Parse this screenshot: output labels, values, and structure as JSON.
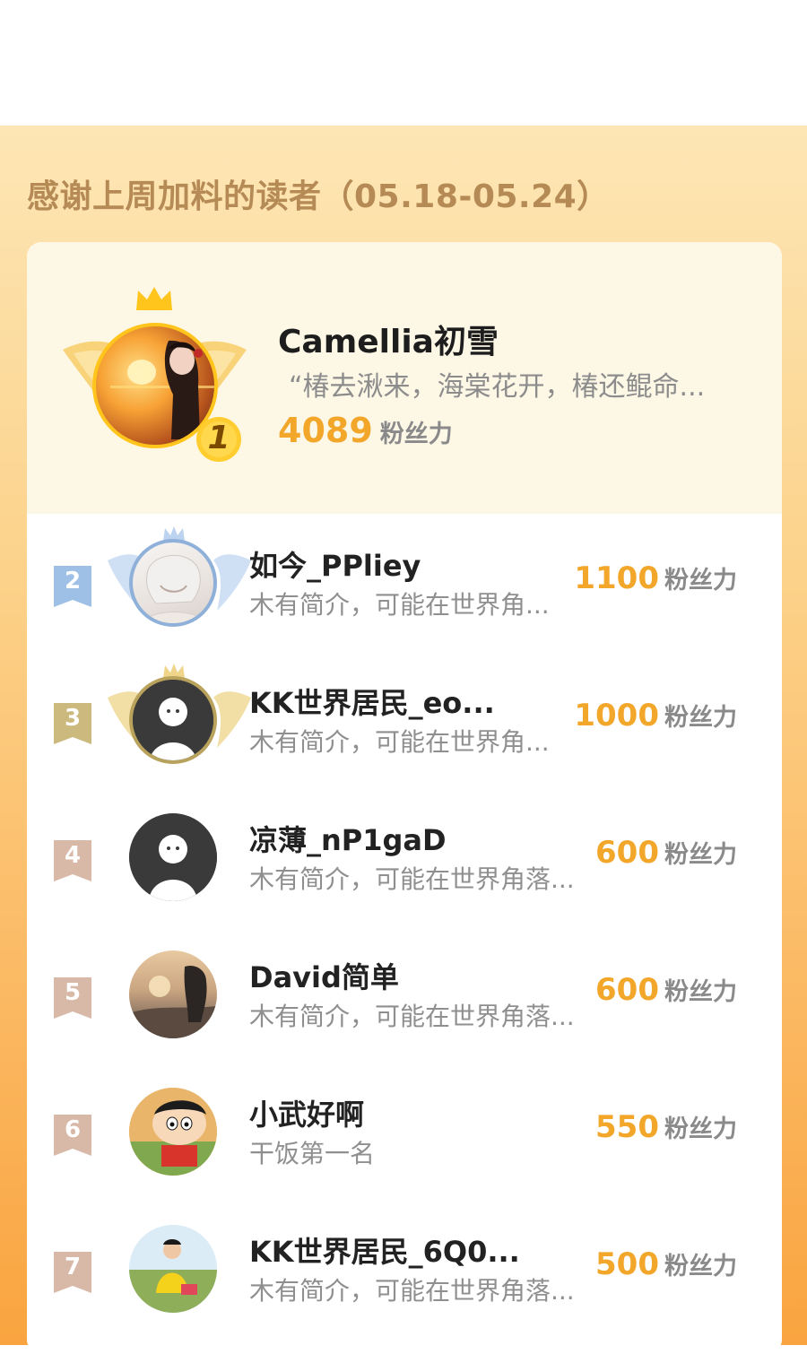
{
  "header": {
    "title": "感谢上周加料的读者（05.18-05.24）"
  },
  "colors": {
    "accent": "#f2a62a",
    "gold": "#ffc51c",
    "silver": "#9fb8d8",
    "bronze": "#c9b06b",
    "rank_other": "#d9b9a6"
  },
  "top_reader": {
    "rank": "1",
    "name": "Camellia初雪",
    "bio": "“椿去湫来，海棠花开，椿还鲲命...",
    "score": "4089",
    "unit": "粉丝力",
    "icon": "crown-icon"
  },
  "readers": [
    {
      "rank": "2",
      "name": "如今_PPliey",
      "bio": "木有简介，可能在世界角...",
      "score": "1100",
      "unit": "粉丝力"
    },
    {
      "rank": "3",
      "name": "KK世界居民_eo...",
      "bio": "木有简介，可能在世界角...",
      "score": "1000",
      "unit": "粉丝力"
    },
    {
      "rank": "4",
      "name": "凉薄_nP1gaD",
      "bio": "木有简介，可能在世界角落...",
      "score": "600",
      "unit": "粉丝力"
    },
    {
      "rank": "5",
      "name": "David简单",
      "bio": "木有简介，可能在世界角落...",
      "score": "600",
      "unit": "粉丝力"
    },
    {
      "rank": "6",
      "name": "小武好啊",
      "bio": "干饭第一名",
      "score": "550",
      "unit": "粉丝力"
    },
    {
      "rank": "7",
      "name": "KK世界居民_6Q0...",
      "bio": "木有简介，可能在世界角落...",
      "score": "500",
      "unit": "粉丝力"
    }
  ]
}
